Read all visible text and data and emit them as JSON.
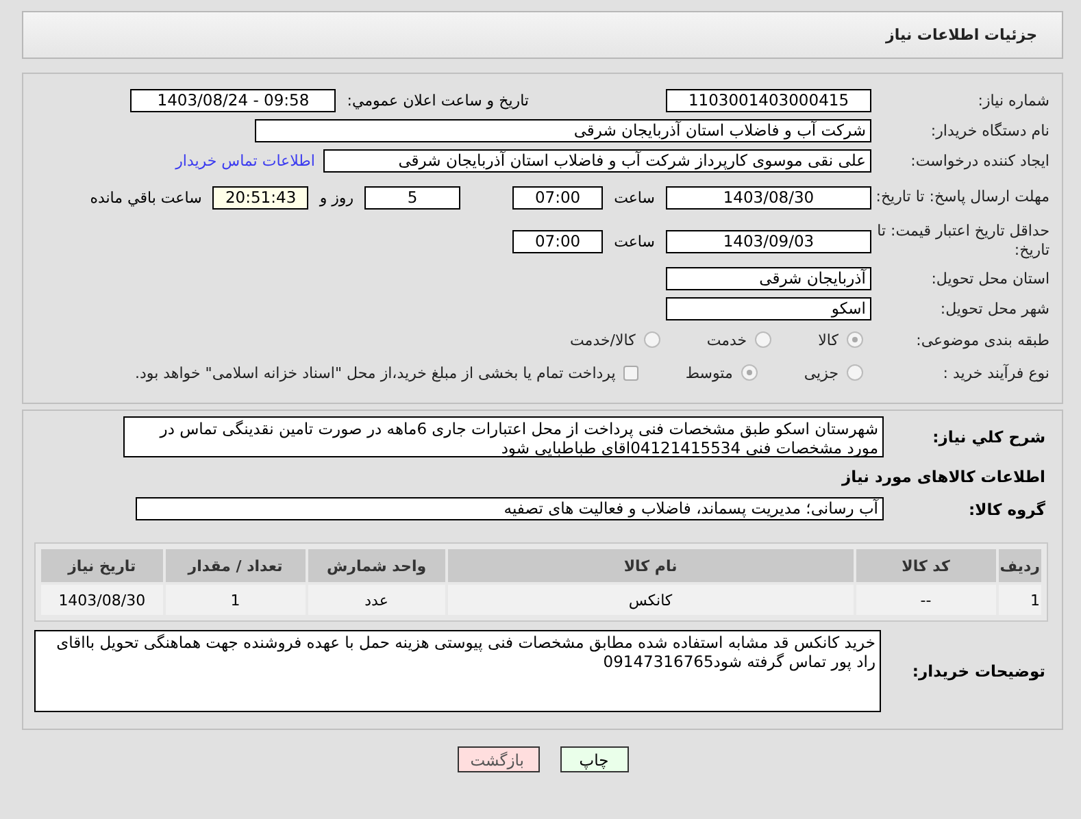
{
  "title": "جزئیات اطلاعات نیاز",
  "need_number": {
    "label": "شماره نیاز:",
    "value": "1103001403000415"
  },
  "announce": {
    "label": "تاريخ و ساعت اعلان عمومي:",
    "value": "1403/08/24 - 09:58"
  },
  "buyer": {
    "label": "نام دستگاه خریدار:",
    "value": "شرکت آب و فاضلاب استان آذربایجان شرقی"
  },
  "creator": {
    "label": "ایجاد کننده درخواست:",
    "value": "علی نقی موسوی کارپرداز شرکت آب و فاضلاب استان آذربایجان شرقی",
    "link": "اطلاعات تماس خریدار"
  },
  "response_deadline": {
    "label": "مهلت ارسال پاسخ: تا تاریخ:",
    "date": "1403/08/30",
    "time_label": "ساعت",
    "time": "07:00",
    "days": "5",
    "days_label": "روز و",
    "remaining": "20:51:43",
    "remaining_label": "ساعت باقي مانده"
  },
  "price_validity": {
    "label": "حداقل تاریخ اعتبار قیمت: تا تاریخ:",
    "date": "1403/09/03",
    "time_label": "ساعت",
    "time": "07:00"
  },
  "province": {
    "label": "استان محل تحویل:",
    "value": "آذربایجان شرقی"
  },
  "city": {
    "label": "شهر محل تحویل:",
    "value": "اسکو"
  },
  "category": {
    "label": "طبقه بندی موضوعی:",
    "options": [
      {
        "label": "کالا",
        "selected": true
      },
      {
        "label": "خدمت",
        "selected": false
      },
      {
        "label": "کالا/خدمت",
        "selected": false
      }
    ]
  },
  "process": {
    "label": "نوع فرآیند خرید :",
    "options": [
      {
        "label": "جزیی",
        "selected": false
      },
      {
        "label": "متوسط",
        "selected": true
      }
    ],
    "treasury": {
      "label": "پرداخت تمام یا بخشی از مبلغ خرید،از محل \"اسناد خزانه اسلامی\" خواهد بود.",
      "checked": false
    }
  },
  "description": {
    "label": "شرح کلي نياز:",
    "value": "شهرستان اسکو طبق مشخصات فنی پرداخت از محل اعتبارات جاری 6ماهه در صورت تامین نقدینگی تماس در مورد مشخصات فنی 04121415534اقای طباطبایی شود"
  },
  "goods_heading": "اطلاعات کالاهای مورد نیاز",
  "goods_group": {
    "label": "گروه کالا:",
    "value": "آب رسانی؛ مدیریت پسماند، فاضلاب و فعالیت های تصفیه"
  },
  "table": {
    "columns": [
      "ردیف",
      "کد کالا",
      "نام کالا",
      "واحد شمارش",
      "تعداد / مقدار",
      "تاریخ نیاز"
    ],
    "rows": [
      [
        "1",
        "--",
        "کانکس",
        "عدد",
        "1",
        "1403/08/30"
      ]
    ]
  },
  "buyer_notes": {
    "label": "توضیحات خریدار:",
    "value": "خرید کانکس قد مشابه استفاده شده مطابق مشخصات فنی پیوستی  هزینه حمل با عهده فروشنده جهت هماهنگی تحویل بااقای راد پور تماس گرفته شود09147316765"
  },
  "buttons": [
    {
      "label": "چاپ",
      "kind": "print"
    },
    {
      "label": "بازگشت",
      "kind": "back"
    }
  ]
}
